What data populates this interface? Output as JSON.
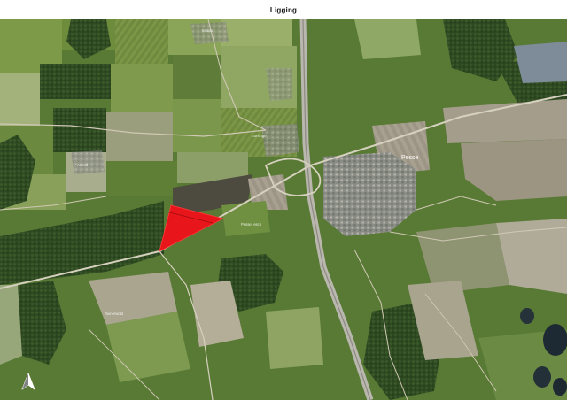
{
  "header": {
    "title": "Ligging"
  },
  "map": {
    "type": "satellite",
    "places": {
      "pesse": "Pesse",
      "eursinge": "Eursinge",
      "kraloo": "Kraloo",
      "anholt": "Anholt",
      "pesser_esch": "Pesser esch",
      "ruinerwold": "Ruinerwold"
    },
    "highlight": {
      "label": "parcel",
      "color": "#e8161a"
    },
    "north_arrow": {
      "icon": "north-arrow-icon"
    }
  }
}
